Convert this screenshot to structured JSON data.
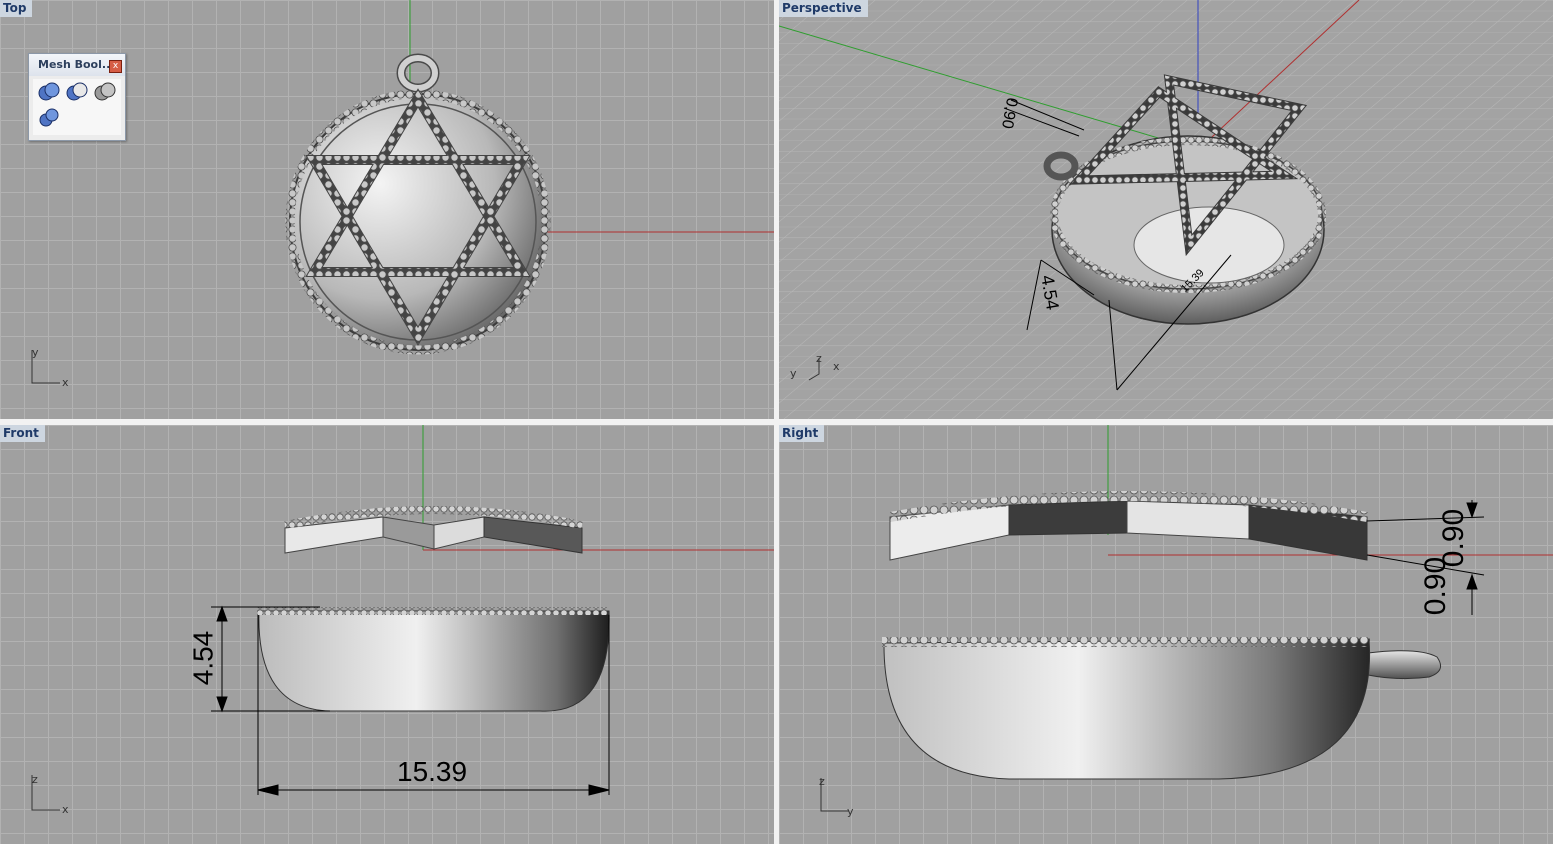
{
  "viewports": {
    "top": {
      "label": "Top",
      "axes": {
        "a": "y",
        "b": "x"
      }
    },
    "perspective": {
      "label": "Perspective",
      "axes": {
        "z": "z",
        "y": "y",
        "x": "x"
      },
      "dims": {
        "d1": "4.54",
        "d2": "0.90",
        "d3": "15.39"
      }
    },
    "front": {
      "label": "Front",
      "axes": {
        "a": "z",
        "b": "x"
      },
      "dims": {
        "height": "4.54",
        "width": "15.39"
      }
    },
    "right": {
      "label": "Right",
      "axes": {
        "a": "z",
        "b": "y"
      },
      "dims": {
        "t1": "0.90",
        "t2": "0.90"
      }
    }
  },
  "panel": {
    "title": "Mesh Bool...",
    "close": "x",
    "tools": [
      "mesh-union-icon",
      "mesh-difference-icon",
      "mesh-intersection-icon",
      "mesh-split-icon"
    ]
  },
  "colors": {
    "viewport_bg": "#a0a0a0",
    "grid": "#b2b2b2",
    "x_axis": "#b03030",
    "y_axis": "#2e9e2e",
    "z_axis": "#3040c0",
    "label_bg": "#cdd6e0"
  }
}
